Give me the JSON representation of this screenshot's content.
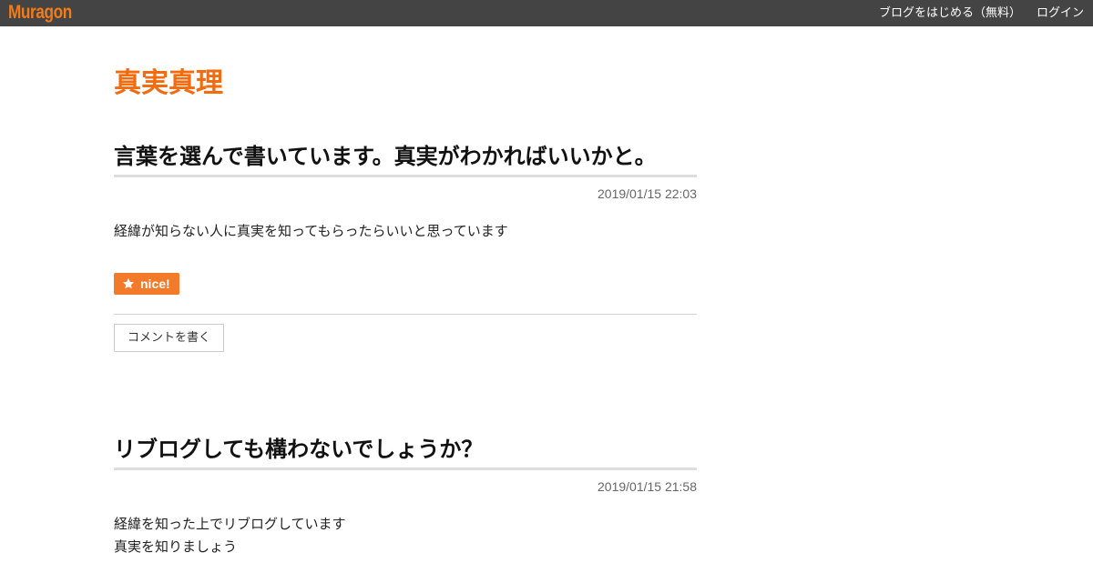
{
  "topbar": {
    "logo": "Muragon",
    "nav": [
      {
        "label": "ブログをはじめる（無料）"
      },
      {
        "label": "ログイン"
      }
    ]
  },
  "blog": {
    "title": "真実真理"
  },
  "posts": [
    {
      "title": "言葉を選んで書いています。真実がわかればいいかと。",
      "date": "2019/01/15 22:03",
      "body": [
        "経緯が知らない人に真実を知ってもらったらいいと思っています"
      ],
      "nice_label": "nice!",
      "comment_label": "コメントを書く"
    },
    {
      "title": "リブログしても構わないでしょうか？",
      "date": "2019/01/15 21:58",
      "body": [
        "経緯を知った上でリブログしています",
        "真実を知りましょう"
      ]
    }
  ],
  "icons": {
    "nice": "star-icon"
  },
  "colors": {
    "accent": "#f26b0f",
    "topbar": "#444444",
    "nice_button": "#f27b2a"
  }
}
